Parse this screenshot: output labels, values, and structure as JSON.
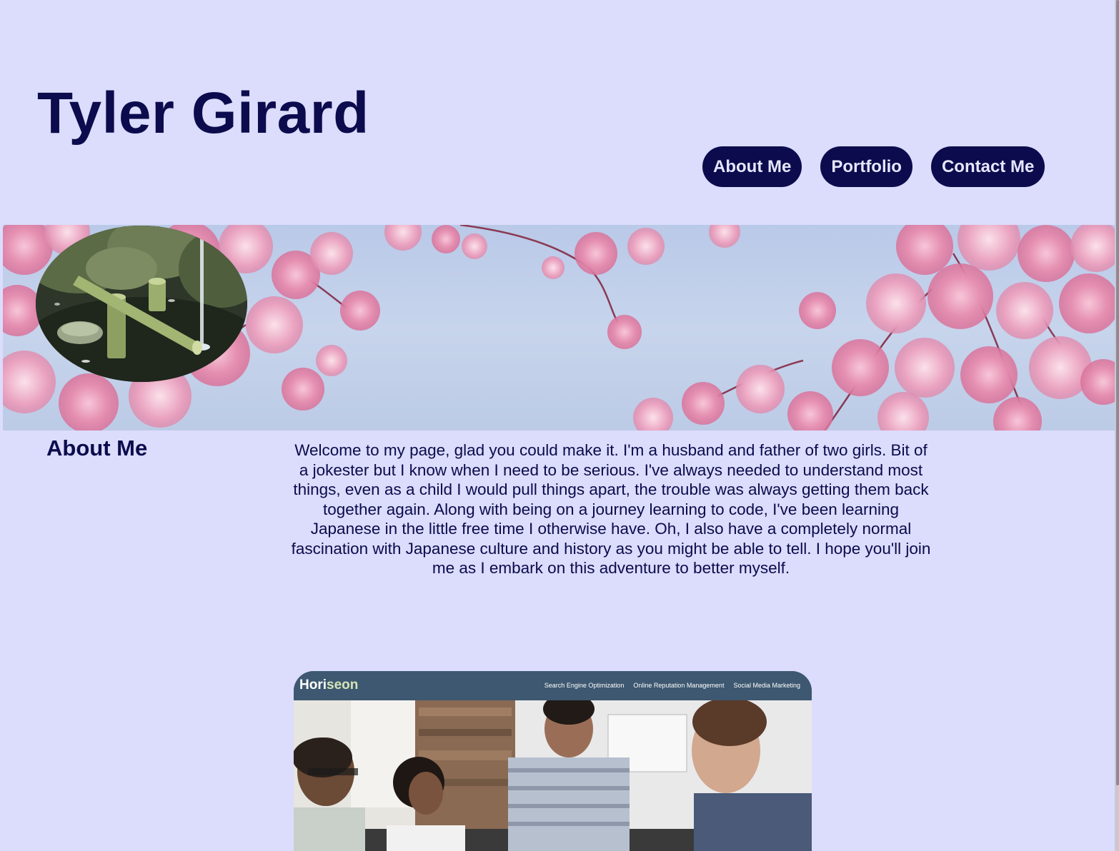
{
  "header": {
    "title": "Tyler Girard"
  },
  "nav": {
    "items": [
      {
        "label": "About Me"
      },
      {
        "label": "Portfolio"
      },
      {
        "label": "Contact Me"
      }
    ]
  },
  "about": {
    "heading": "About Me",
    "text": "Welcome to my page, glad you could make it. I'm a husband and father of two girls. Bit of a jokester but I know when I need to be serious. I've always needed to understand most things, even as a child I would pull things apart, the trouble was always getting them back together again. Along with being on a journey learning to code, I've been learning Japanese in the little free time I otherwise have. Oh, I also have a completely normal fascination with Japanese culture and history as you might be able to tell. I hope you'll join me as I embark on this adventure to better myself."
  },
  "portfolio": {
    "brand_prefix": "Hori",
    "brand_suffix": "seon",
    "links": [
      "Search Engine Optimization",
      "Online Reputation Management",
      "Social Media Marketing"
    ]
  },
  "colors": {
    "background": "#dcdcfc",
    "accent": "#0b0b4d",
    "nav_text": "#e6e6ff",
    "card_header": "#3d5870"
  },
  "images": {
    "hero": "cherry-blossom-banner",
    "avatar": "bamboo-fountain-illustration",
    "portfolio_screenshot": "team-meeting-photo"
  }
}
